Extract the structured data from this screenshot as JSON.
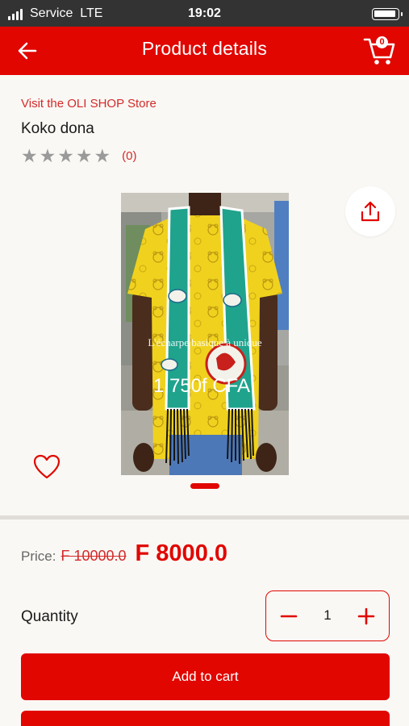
{
  "status_bar": {
    "carrier": "Service",
    "network": "LTE",
    "time": "19:02"
  },
  "header": {
    "title": "Product details",
    "cart_count": "0",
    "back_icon": "arrow-left-icon",
    "cart_icon": "cart-icon"
  },
  "product": {
    "store_link": "Visit the OLI SHOP Store",
    "name": "Koko dona",
    "rating_stars": 0,
    "rating_max": 5,
    "review_count": "(0)",
    "image": {
      "description": "Person in yellow patterned shirt wearing a teal scarf with black fringes",
      "overlay_caption": "L'écharpe basique à unique",
      "overlay_price": "1 750f CFA"
    },
    "slides_total": 1,
    "slide_active": 1
  },
  "price": {
    "label": "Price:",
    "old": "F 10000.0",
    "current": "F 8000.0"
  },
  "quantity": {
    "label": "Quantity",
    "value": "1"
  },
  "actions": {
    "add_to_cart": "Add to cart"
  },
  "colors": {
    "brand_red": "#e10600",
    "status_bar": "#333333",
    "background": "#faf8f4",
    "accent_text": "#d32a2a"
  }
}
